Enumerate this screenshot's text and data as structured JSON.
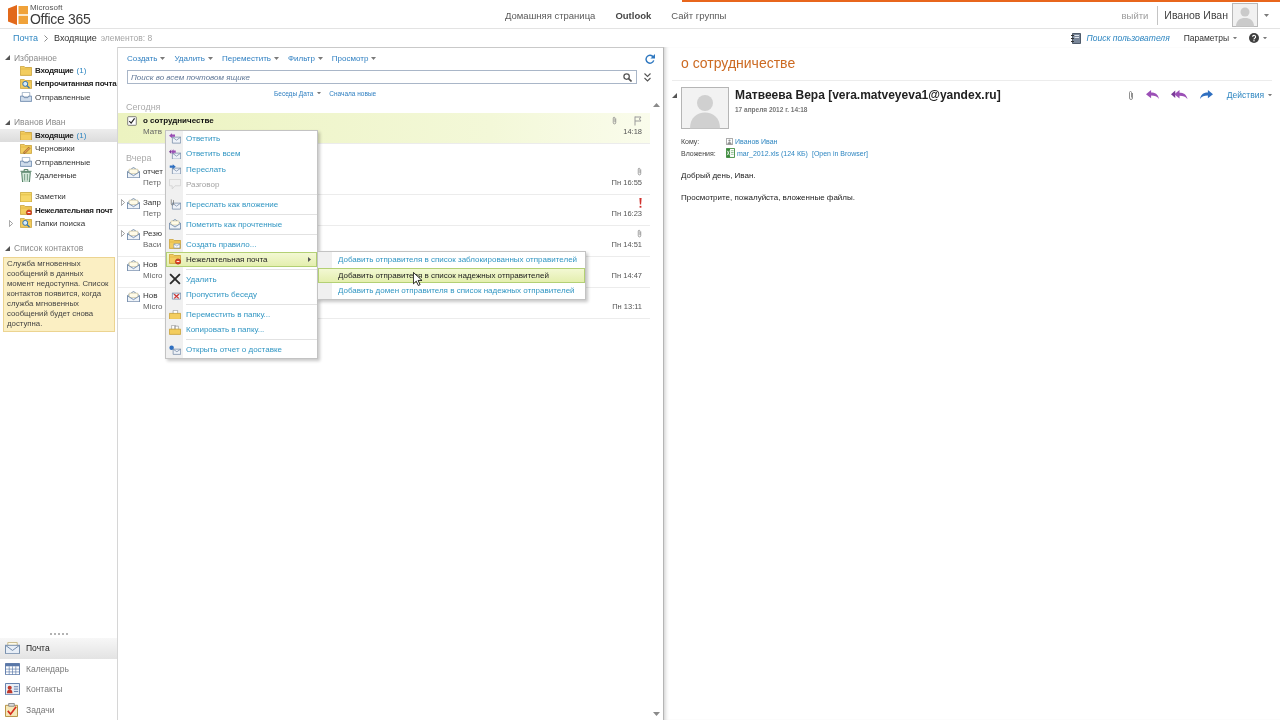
{
  "logo": {
    "brand": "Microsoft",
    "product": "Office 365"
  },
  "top_nav": [
    {
      "label": "Домашняя страница",
      "selected": false
    },
    {
      "label": "Outlook",
      "selected": true
    },
    {
      "label": "Сайт группы",
      "selected": false
    }
  ],
  "user_bar": {
    "sign_out": "выйти",
    "user_name": "Иванов Иван"
  },
  "breadcrumb": {
    "path": [
      "Почта",
      "Входящие"
    ],
    "item_count": "элементов: 8"
  },
  "utility_bar": {
    "find_user": "Поиск пользователя",
    "settings": "Параметры"
  },
  "sidebar": {
    "sections": [
      {
        "title": "Избранное",
        "expanded": true,
        "groups": [
          {
            "folders": [
              {
                "kind": "inbox",
                "label": "Входящие",
                "count": "(1)",
                "unread": true,
                "selected": false
              },
              {
                "kind": "search",
                "label": "Непрочитанная почта",
                "unread": true,
                "selected": false
              },
              {
                "kind": "sent",
                "label": "Отправленные",
                "unread": false,
                "selected": false
              }
            ]
          }
        ]
      },
      {
        "title": "Иванов Иван",
        "expanded": true,
        "groups": [
          {
            "folders": [
              {
                "kind": "inbox",
                "label": "Входящие",
                "count": "(1)",
                "unread": true,
                "selected": true
              },
              {
                "kind": "drafts",
                "label": "Черновики",
                "unread": false,
                "selected": false
              },
              {
                "kind": "sent",
                "label": "Отправленные",
                "unread": false,
                "selected": false
              },
              {
                "kind": "deleted",
                "label": "Удаленные",
                "unread": false,
                "selected": false
              }
            ]
          },
          {
            "folders": [
              {
                "kind": "notes",
                "label": "Заметки",
                "unread": false,
                "selected": false
              },
              {
                "kind": "junk",
                "label": "Нежелательная почт",
                "unread": true,
                "selected": false
              },
              {
                "kind": "search",
                "label": "Папки поиска",
                "unread": false,
                "selected": false,
                "expanded": false
              }
            ]
          }
        ]
      },
      {
        "title": "Список контактов",
        "expanded": true,
        "notice": "Служба мгновенных сообщений в данных момент недоступна. Список контактов появится, когда служба мгновенных сообщений будет снова доступна."
      }
    ]
  },
  "module_nav": [
    {
      "kind": "mail",
      "label": "Почта",
      "selected": true
    },
    {
      "kind": "calendar",
      "label": "Календарь",
      "selected": false
    },
    {
      "kind": "contacts",
      "label": "Контакты",
      "selected": false
    },
    {
      "kind": "tasks",
      "label": "Задачи",
      "selected": false
    }
  ],
  "toolbar": [
    "Создать",
    "Удалить",
    "Переместить",
    "Фильтр",
    "Просмотр"
  ],
  "search": {
    "placeholder": "Поиск во всем почтовом ящике"
  },
  "sort": {
    "arrange_by": "Беседы Дата",
    "order": "Сначала новые"
  },
  "message_groups": [
    {
      "label": "Сегодня",
      "messages": [
        {
          "subject": "о сотрудничестве",
          "sender": "Матв",
          "time": "14:18",
          "selected": true,
          "unread": true,
          "attachment": true,
          "important": false
        }
      ]
    },
    {
      "label": "Вчера",
      "messages": [
        {
          "subject": "отчет",
          "sender": "Петр",
          "time": "Пн 16:55",
          "selected": false,
          "unread": false,
          "attachment": true,
          "important": false
        },
        {
          "subject": "Запр",
          "sender": "Петр",
          "time": "Пн 16:23",
          "selected": false,
          "unread": false,
          "attachment": false,
          "important": true,
          "expanded": false
        },
        {
          "subject": "Резю",
          "sender": "Васи",
          "time": "Пн 14:51",
          "selected": false,
          "unread": false,
          "attachment": true,
          "important": false,
          "expanded": false
        },
        {
          "subject": "Нов",
          "sender": "Micro",
          "time": "Пн 14:47",
          "selected": false,
          "unread": false,
          "attachment": false,
          "important": false
        },
        {
          "subject": "Нов",
          "sender": "Micro",
          "time": "Пн 13:11",
          "selected": false,
          "unread": false,
          "attachment": false,
          "important": false
        }
      ]
    }
  ],
  "context_menu": {
    "groups": [
      {
        "items": [
          {
            "kind": "reply",
            "label": "Ответить",
            "disabled": false,
            "selected": false
          },
          {
            "kind": "replyall",
            "label": "Ответить всем",
            "disabled": false,
            "selected": false
          },
          {
            "kind": "forward",
            "label": "Переслать",
            "disabled": false,
            "selected": false
          },
          {
            "kind": "conversation",
            "label": "Разговор",
            "disabled": true,
            "selected": false
          }
        ]
      },
      {
        "items": [
          {
            "kind": "attach",
            "label": "Переслать как вложение",
            "disabled": false,
            "selected": false
          }
        ]
      },
      {
        "items": [
          {
            "kind": "read",
            "label": "Пометить как прочтенные",
            "disabled": false,
            "selected": false
          }
        ]
      },
      {
        "items": [
          {
            "kind": "rule",
            "label": "Создать правило...",
            "disabled": false,
            "selected": false
          },
          {
            "kind": "junk",
            "label": "Нежелательная почта",
            "disabled": false,
            "selected": true,
            "submenu": [
              {
                "label": "Добавить отправителя в список заблокированных отправителей",
                "selected": false
              },
              {
                "label": "Добавить отправителя в список надежных отправителей",
                "selected": true
              },
              {
                "label": "Добавить домен отправителя в список надежных отправителей",
                "selected": false
              }
            ]
          }
        ]
      },
      {
        "items": [
          {
            "kind": "delete",
            "label": "Удалить",
            "disabled": false,
            "selected": false
          },
          {
            "kind": "ignore",
            "label": "Пропустить беседу",
            "disabled": false,
            "selected": false
          }
        ]
      },
      {
        "items": [
          {
            "kind": "move",
            "label": "Переместить в папку...",
            "disabled": false,
            "selected": false
          },
          {
            "kind": "copy",
            "label": "Копировать в папку...",
            "disabled": false,
            "selected": false
          }
        ]
      },
      {
        "items": [
          {
            "kind": "receipt",
            "label": "Открыть отчет о доставке",
            "disabled": false,
            "selected": false
          }
        ]
      }
    ]
  },
  "reading_pane": {
    "subject": "о сотрудничестве",
    "expanded": true,
    "sender": "Матвеева Вера [vera.matveyeva1@yandex.ru]",
    "sent": "17 апреля 2012 г. 14:18",
    "actions": "Действия",
    "fields": [
      {
        "kind": "recipient",
        "label": "Кому:",
        "value": "Иванов Иван"
      },
      {
        "kind": "attachment",
        "label": "Вложения:",
        "value": "mar_2012.xls (124 КБ)",
        "link": "[Open in Browser]"
      }
    ],
    "body": [
      "Добрый день, Иван.",
      "Просмотрите, пожалуйста, вложенные файлы."
    ]
  }
}
